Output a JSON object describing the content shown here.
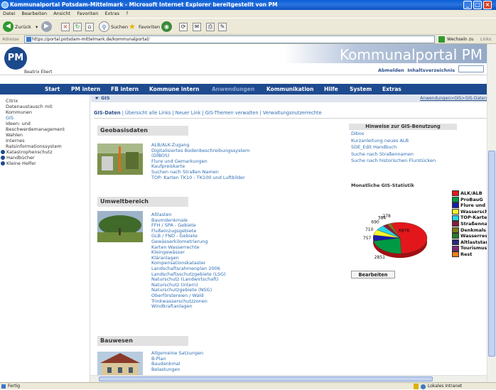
{
  "window": {
    "title": "Kommunalportal Potsdam-Mittelmark - Microsoft Internet Explorer bereitgestellt von PM"
  },
  "menu": [
    "Datei",
    "Bearbeiten",
    "Ansicht",
    "Favoriten",
    "Extras",
    "?"
  ],
  "toolbar": {
    "back": "Zurück",
    "search": "Suchen",
    "favorites": "Favoriten"
  },
  "address": {
    "label": "Adresse",
    "url": "https://portal.potsdam-mittelmark.de/kommunalportal/",
    "go": "Wechseln zu",
    "links": "Links"
  },
  "header": {
    "logo": "PM",
    "portal_title": "Kommunalportal PM",
    "user": "Beatrix Ebert",
    "logout": "Abmelden",
    "index": "Inhaltsverzeichnis"
  },
  "nav": [
    "Start",
    "PM intern",
    "FB intern",
    "Kommune intern",
    "Anwendungen",
    "Kommunikation",
    "Hilfe",
    "System",
    "Extras"
  ],
  "sidebar": [
    "Citrix",
    "Datenaustausch mit Kommunen",
    "GIS",
    "Ideen- und Beschwerdemanagement",
    "Wahlen",
    "Internes Ratsinformationssystem",
    "Katastrophenschutz",
    "Handbücher",
    "Kleine Helfer"
  ],
  "breadcrumb": {
    "title": "GIS",
    "path": "Anwendungen>GIS>GIS-Daten"
  },
  "tabs": {
    "active": "GIS-Daten",
    "others": "Übersicht alle Links | Neuer Link | GIS-Themen verwalten | Verwaltungsnutzerrechte"
  },
  "sections": [
    {
      "title": "Geobasisdaten",
      "links": [
        "ALB/ALK-Zugang",
        "Digitalisiertes Bodenbeschreibungssystem",
        "(DIBOS)",
        "Flure und Gemarkungen",
        "Kaufpreiskarte",
        "Suchen nach Straßen Namen",
        "TOP- Karten TK10 - TK100 und Luftbilder"
      ]
    },
    {
      "title": "Umweltbereich",
      "links": [
        "Altlasten",
        "Baumdenkmale",
        "FFH / SPA - Gebiete",
        "Flußeinzugsgebiete",
        "GLB / FND - Gebiete",
        "Gewässerkilometrierung",
        "Karten Wasserrechte",
        "Kleingewässer",
        "Kläranlagen",
        "Kompensationskataster",
        "Landschaftsrahmenplan 2006",
        "Landschaftsschutzgebiete (LSG)",
        "Naturschutz (Landwirtschaft)",
        "Naturschutz (intern)",
        "Naturschutzgebiete (NSG)",
        "Oberförstereien / Wald",
        "Trinkwasserschutzzonen",
        "Windkraftanlagen"
      ]
    },
    {
      "title": "Bauwesen",
      "links": [
        "Allgemeine Satzungen",
        "B-Plan",
        "Baudenkmal",
        "Belastungen"
      ]
    }
  ],
  "hints": {
    "title": "Hinweise zur GIS-Benutzung",
    "links": [
      "Dibos",
      "Kurzanleitung neues ALB",
      "SDE_Edit Handbuch",
      "Suche nach Straßennamen",
      "Suche nach historischen Flurstücken"
    ]
  },
  "stats": {
    "title": "Monatliche GIS-Statistik",
    "edit": "Bearbeiten"
  },
  "chart_data": {
    "type": "pie",
    "title": "",
    "labels": [
      "ALK/ALB",
      "ProBauG",
      "Flure und",
      "Wassersch",
      "TOP-Karte",
      "Straßenna",
      "Denkmals",
      "Wasserres",
      "Altlaststan",
      "Tourismus",
      "Rest"
    ],
    "values": [
      6876,
      2851,
      757,
      710,
      690,
      384,
      278,
      0,
      0,
      0,
      0
    ],
    "colors": [
      "#e3171b",
      "#009944",
      "#1a1aa8",
      "#f7f42a",
      "#29d4e6",
      "#8b1a3a",
      "#7a7a1a",
      "#2a7a2a",
      "#2a2a7a",
      "#7a2a7a",
      "#f07f1a"
    ]
  },
  "status": {
    "left": "Fertig",
    "zone": "Lokales Intranet"
  }
}
